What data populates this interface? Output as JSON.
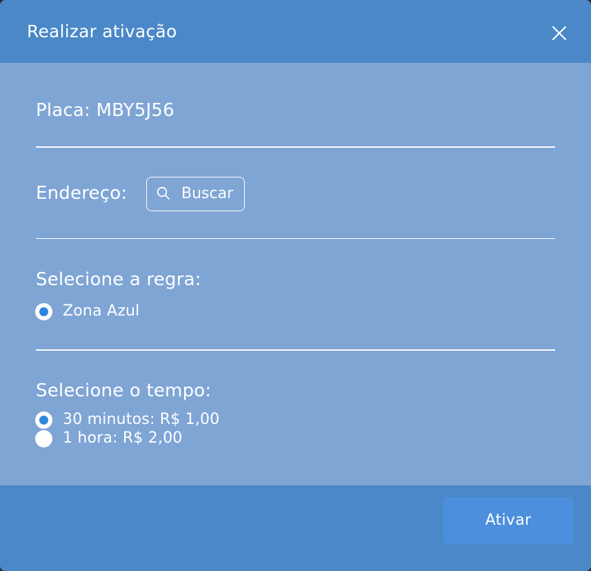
{
  "modal": {
    "title": "Realizar ativação",
    "close_icon": "close-icon"
  },
  "plate": {
    "label": "Placa: MBY5J56"
  },
  "address": {
    "label": "Endereço:",
    "search_button_label": "Buscar",
    "search_icon": "search-icon"
  },
  "rule": {
    "heading": "Selecione a regra:",
    "options": [
      {
        "label": "Zona Azul",
        "selected": true
      }
    ]
  },
  "time": {
    "heading": "Selecione o tempo:",
    "options": [
      {
        "label": "30 minutos: R$ 1,00",
        "selected": true
      },
      {
        "label": "1 hora: R$ 2,00",
        "selected": false
      }
    ]
  },
  "footer": {
    "activate_label": "Ativar"
  },
  "colors": {
    "header_bg": "#4a88c8",
    "body_bg": "#7fa5d5",
    "button_bg": "#4b8fdd",
    "radio_accent": "#2f86e0"
  }
}
